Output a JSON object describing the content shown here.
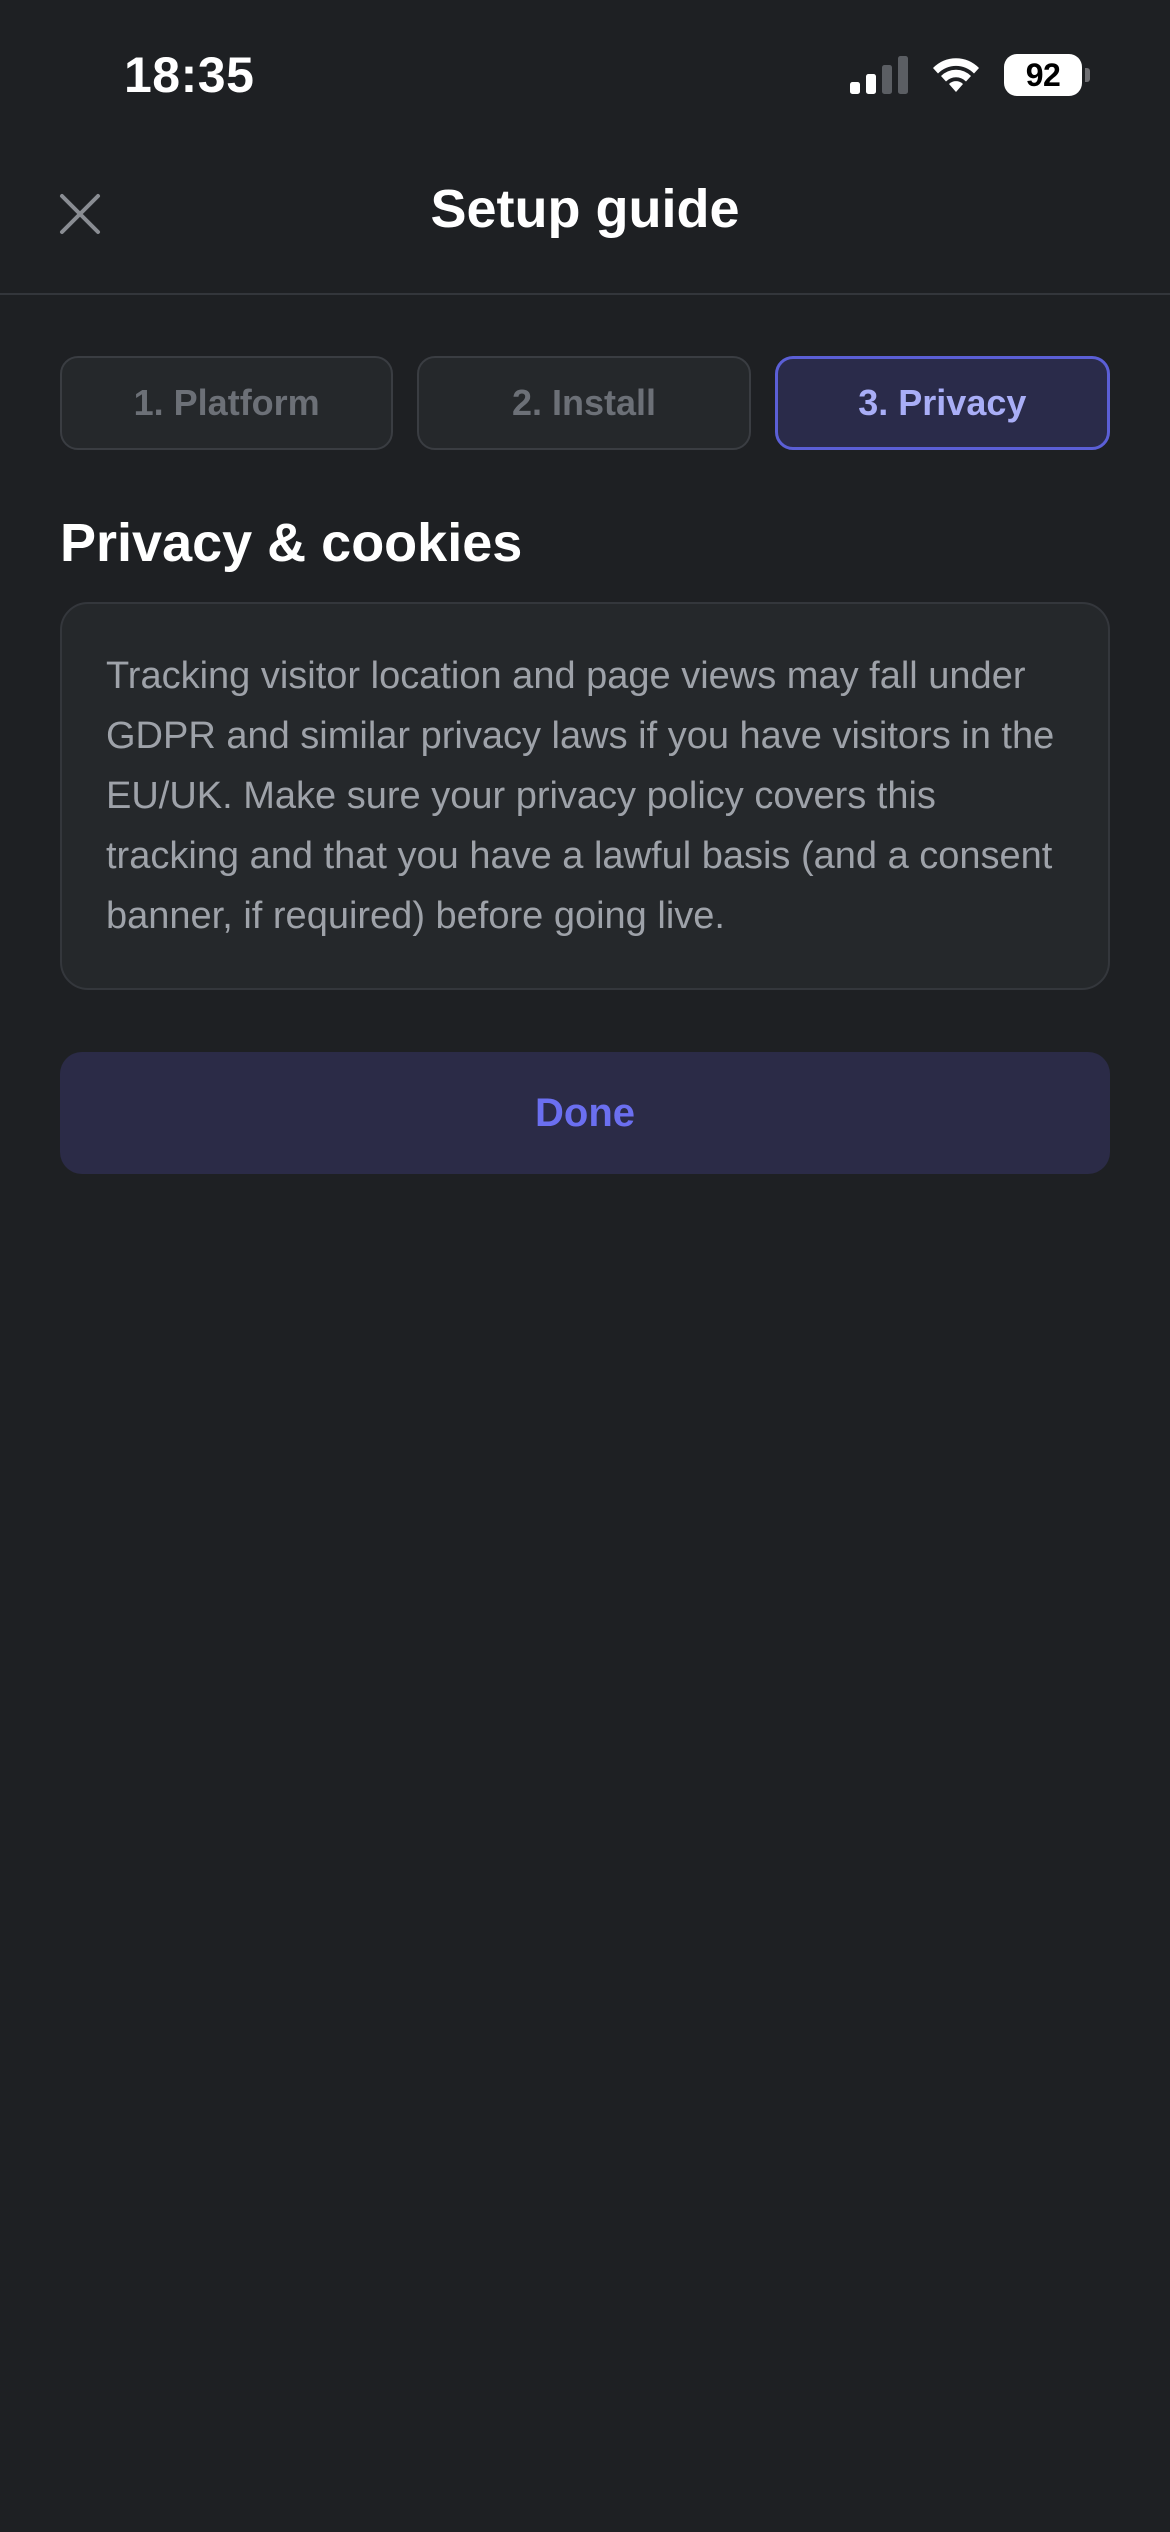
{
  "status_bar": {
    "time": "18:35",
    "battery": "92",
    "icons": [
      "signal-icon",
      "wifi-icon",
      "battery-icon"
    ]
  },
  "header": {
    "title": "Setup guide",
    "close_icon": "close-icon"
  },
  "steps": [
    {
      "label": "1. Platform",
      "active": false
    },
    {
      "label": "2. Install",
      "active": false
    },
    {
      "label": "3. Privacy",
      "active": true
    }
  ],
  "section": {
    "title": "Privacy & cookies",
    "body": "Tracking visitor location and page views may fall under GDPR and similar privacy laws if you have visitors in the EU/UK. Make sure your privacy policy covers this tracking and that you have a lawful basis (and a consent banner, if required) before going live."
  },
  "actions": {
    "done_label": "Done"
  },
  "colors": {
    "background": "#1e2023",
    "accent": "#6b6ff0",
    "active_step_border": "#5b5fd6"
  }
}
